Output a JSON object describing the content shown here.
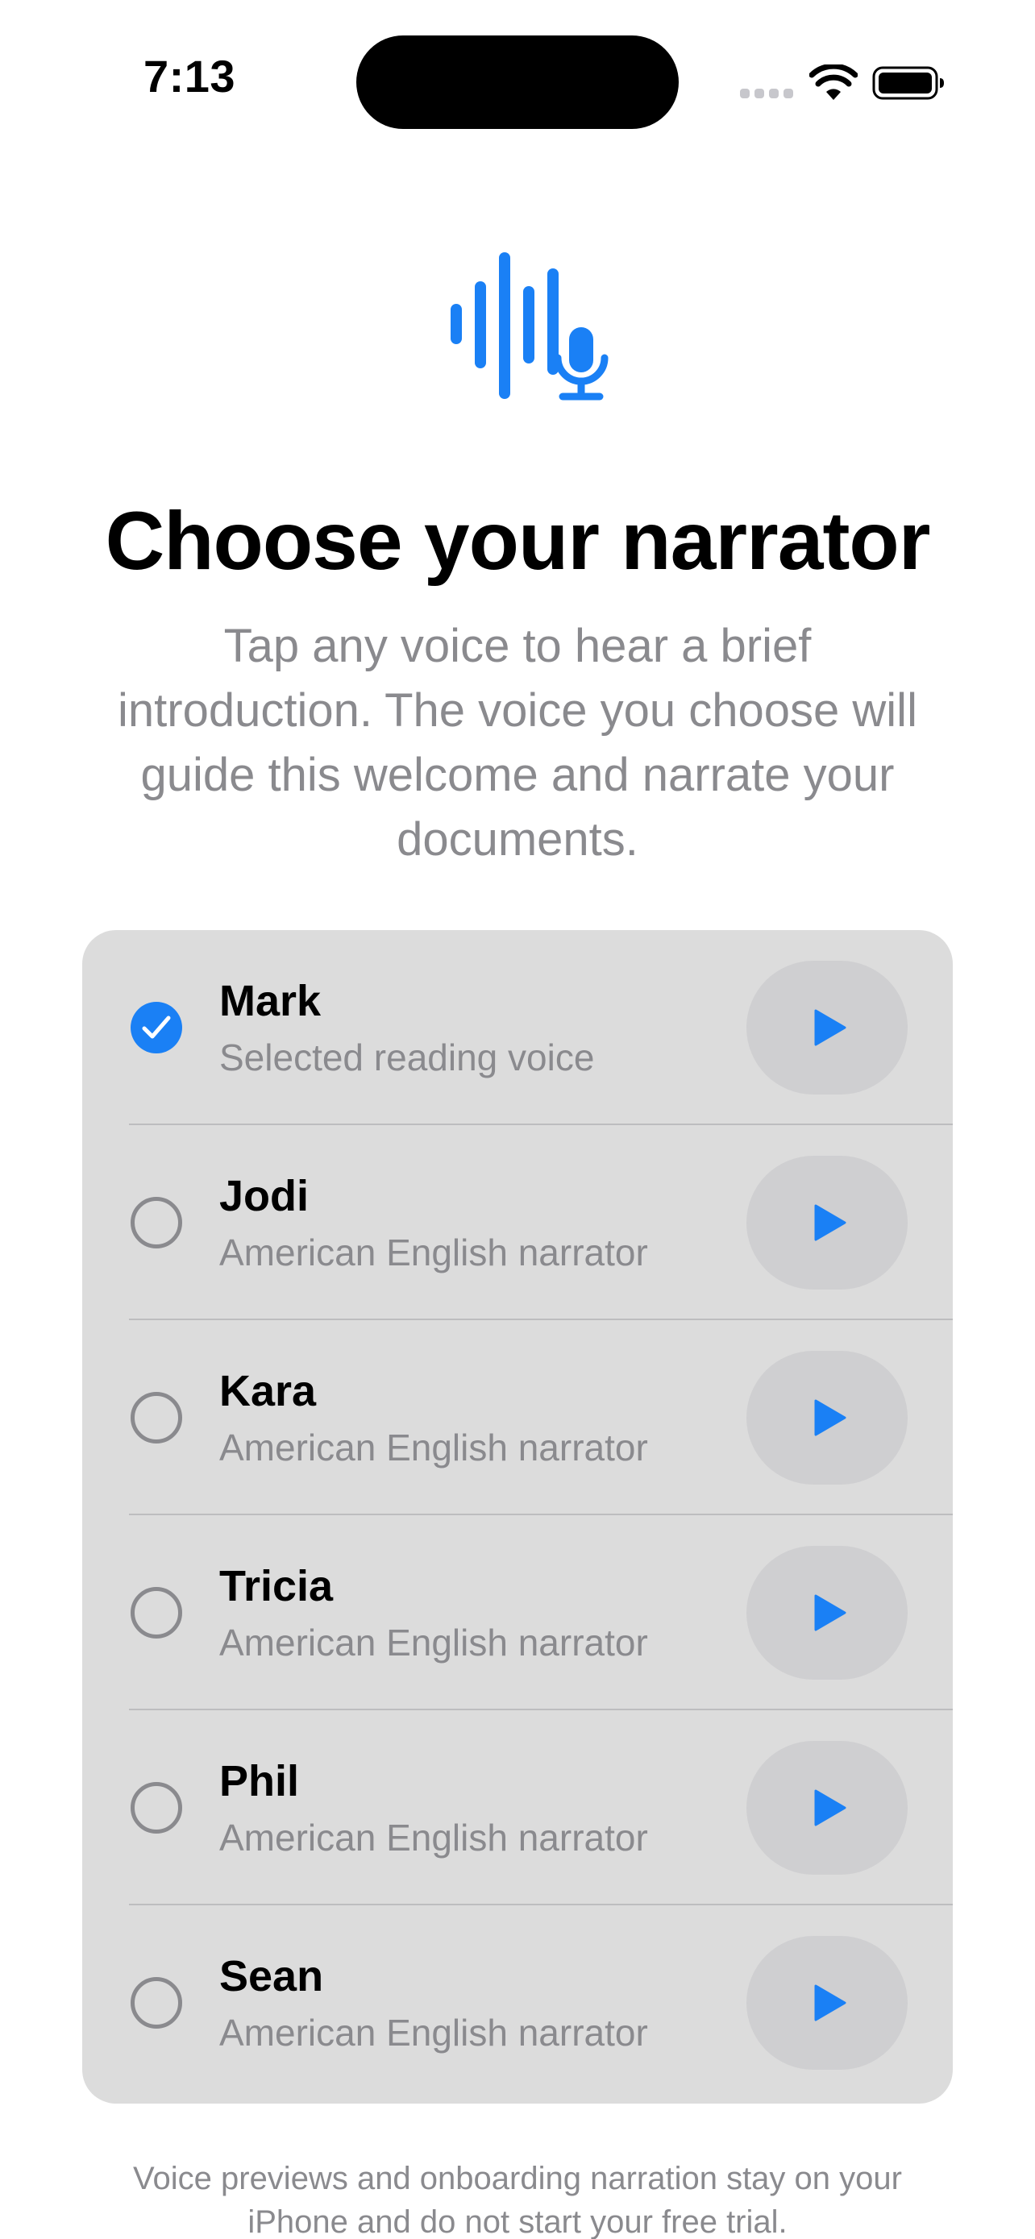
{
  "status_bar": {
    "time": "7:13",
    "icons": [
      "cellular-signal-icon",
      "wifi-icon",
      "battery-icon"
    ]
  },
  "hero": {
    "icon": "waveform-microphone-icon",
    "title": "Choose your narrator",
    "subtitle": "Tap any voice to hear a brief introduction. The voice you choose will guide this welcome and narrate your documents."
  },
  "voices": [
    {
      "name": "Mark",
      "description": "Selected reading voice",
      "selected": true
    },
    {
      "name": "Jodi",
      "description": "American English narrator",
      "selected": false
    },
    {
      "name": "Kara",
      "description": "American English narrator",
      "selected": false
    },
    {
      "name": "Tricia",
      "description": "American English narrator",
      "selected": false
    },
    {
      "name": "Phil",
      "description": "American English narrator",
      "selected": false
    },
    {
      "name": "Sean",
      "description": "American English narrator",
      "selected": false
    }
  ],
  "footer": {
    "note": "Voice previews and onboarding narration stay on your iPhone and do not start your free trial."
  },
  "colors": {
    "accent": "#1a80f5",
    "secondary_text": "#8a8a8e",
    "list_background": "#dcdcdc",
    "play_button_background": "#cfcfd1"
  }
}
